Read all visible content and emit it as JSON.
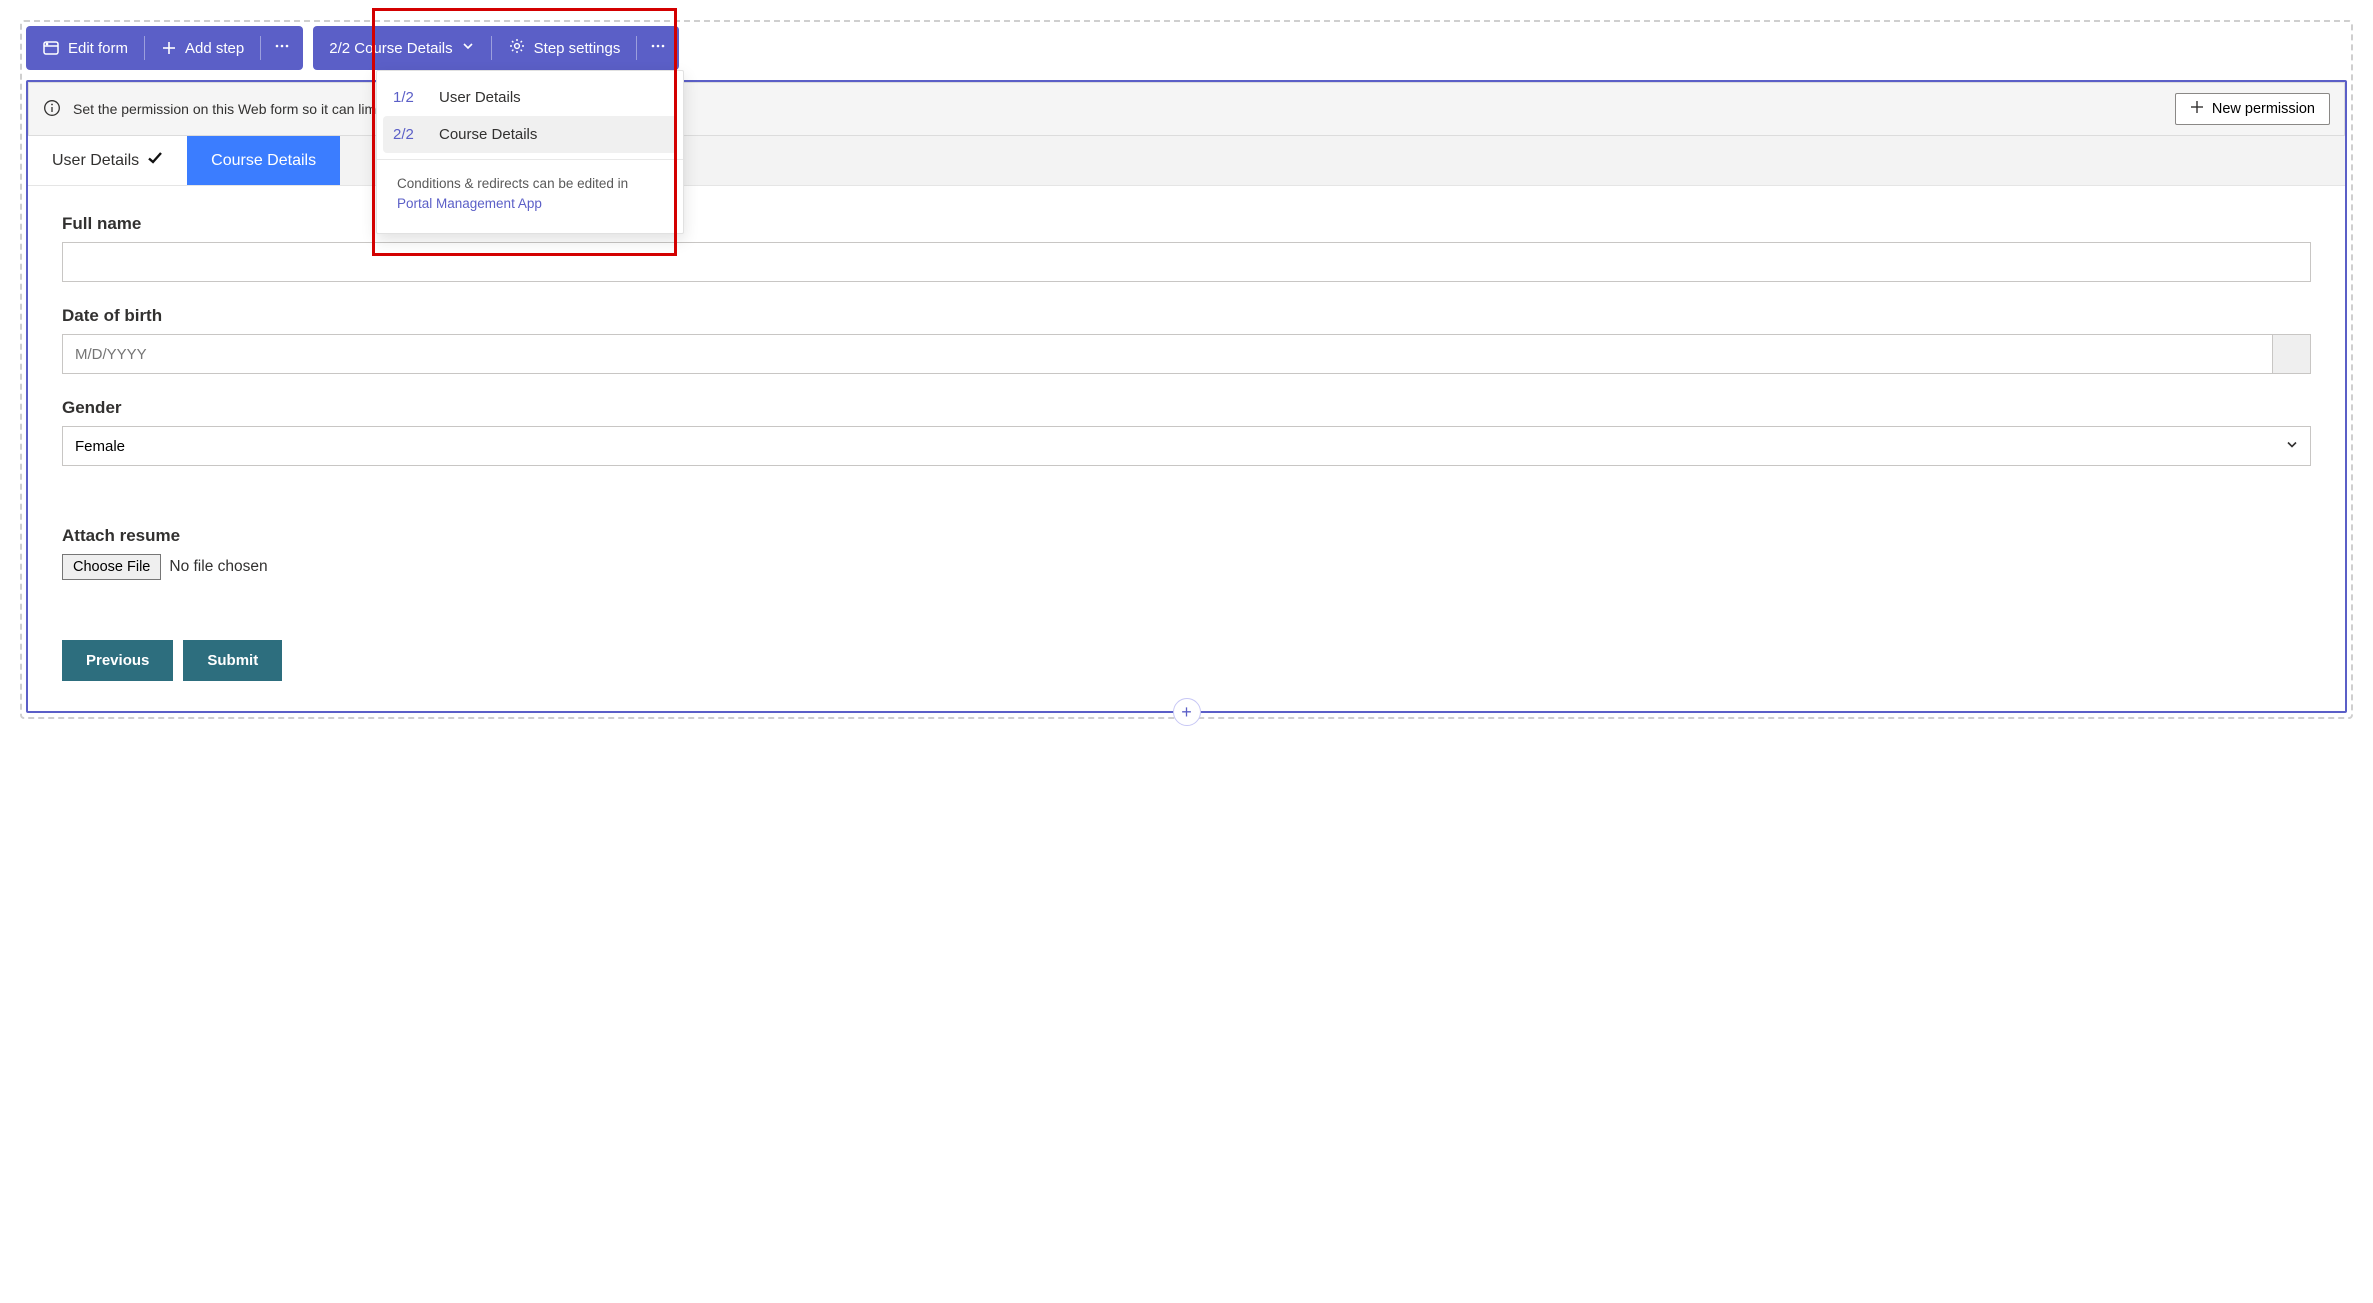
{
  "toolbar1": {
    "edit_form": "Edit form",
    "add_step": "Add step"
  },
  "toolbar2": {
    "step_selector": "2/2 Course Details",
    "step_settings": "Step settings"
  },
  "dropdown": {
    "items": [
      {
        "num": "1/2",
        "label": "User Details"
      },
      {
        "num": "2/2",
        "label": "Course Details"
      }
    ],
    "footer_text": "Conditions & redirects can be edited in",
    "footer_link": "Portal Management App"
  },
  "banner": {
    "text": "Set the permission on this Web form so it can limit the interaction to specific roles.",
    "button": "New permission"
  },
  "tabs": [
    {
      "label": "User Details",
      "state": "completed"
    },
    {
      "label": "Course Details",
      "state": "active"
    }
  ],
  "form": {
    "full_name": {
      "label": "Full name",
      "value": ""
    },
    "dob": {
      "label": "Date of birth",
      "placeholder": "M/D/YYYY"
    },
    "gender": {
      "label": "Gender",
      "value": "Female"
    },
    "attach": {
      "label": "Attach resume",
      "button": "Choose File",
      "status": "No file chosen"
    },
    "previous": "Previous",
    "submit": "Submit"
  }
}
